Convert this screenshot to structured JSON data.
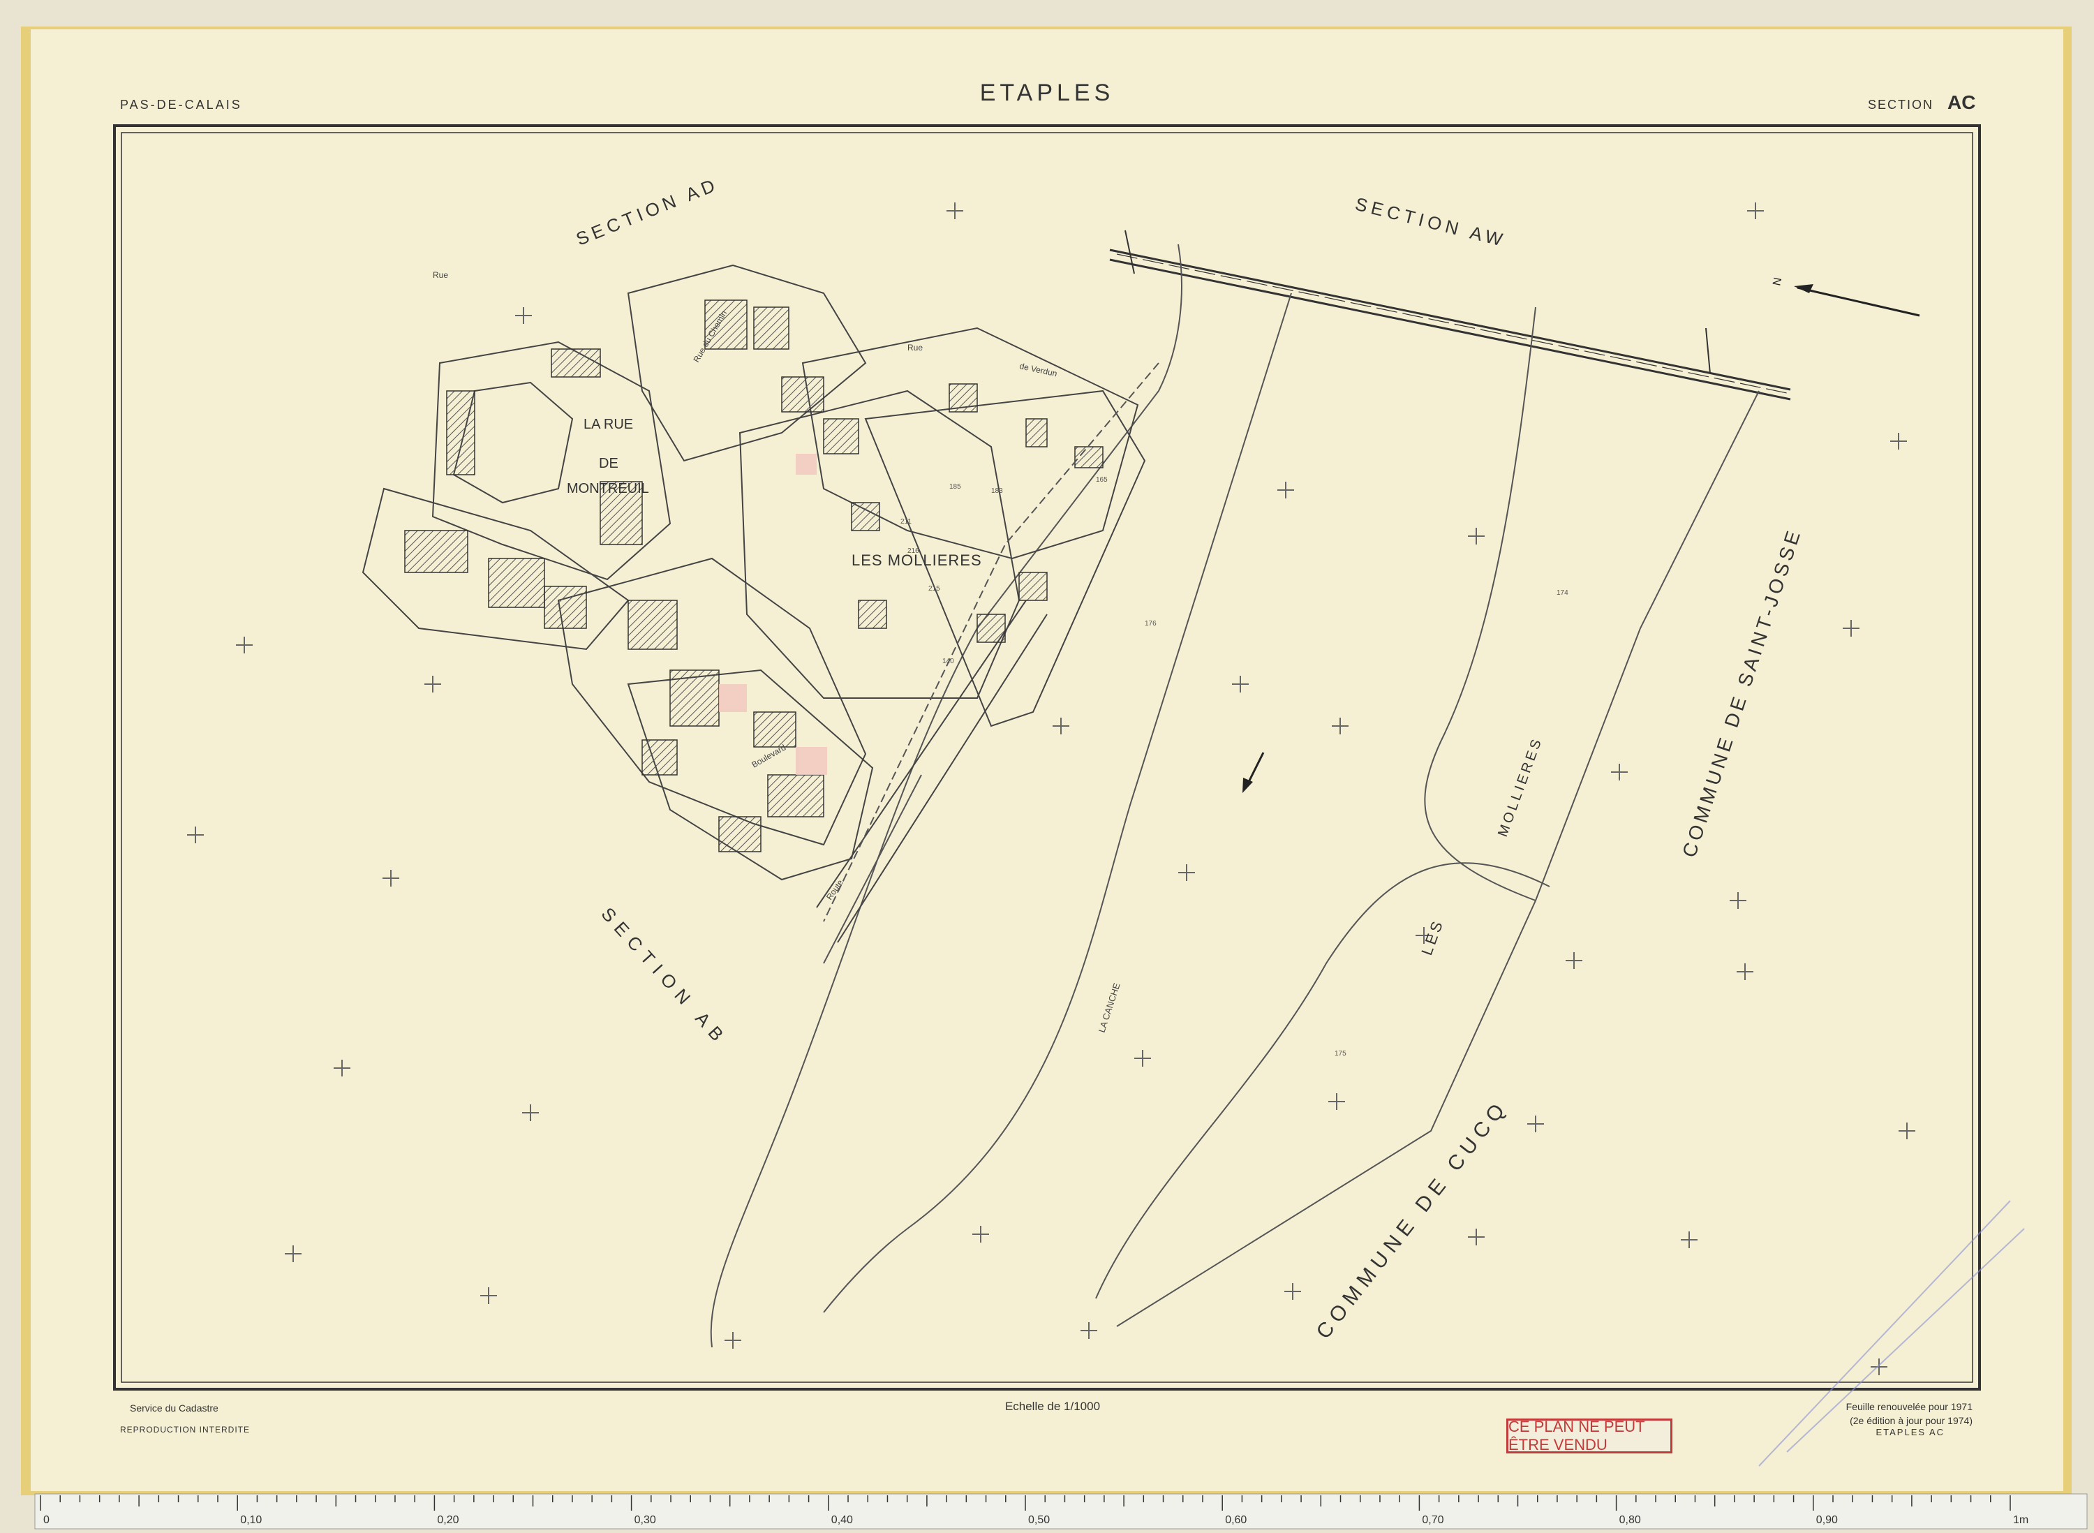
{
  "header": {
    "department": "PAS-DE-CALAIS",
    "commune": "ETAPLES",
    "section_prefix": "SECTION",
    "section_code": "AC"
  },
  "map_labels": {
    "section_ad": "SECTION AD",
    "section_aw": "SECTION AW",
    "section_ab": "SECTION AB",
    "la_rue_1": "LA RUE",
    "la_rue_2": "DE",
    "la_rue_3": "MONTREUIL",
    "les_mollieres": "LES MOLLIERES",
    "les_mollieres_v1": "LES",
    "les_mollieres_v2": "MOLLIERES",
    "commune_saint_josse": "COMMUNE DE SAINT-JOSSE",
    "commune_cucq": "COMMUNE DE CUCQ",
    "la_canche": "LA CANCHE",
    "north": "N",
    "streets": [
      "Rue",
      "de Verdun",
      "Rue du Chemin",
      "Boulevard",
      "Rue",
      "Route"
    ]
  },
  "parcel_numbers": [
    "174",
    "175",
    "176",
    "211",
    "215",
    "216",
    "183",
    "185",
    "140",
    "165"
  ],
  "footer": {
    "left_1": "Service du Cadastre",
    "left_2": "REPRODUCTION INTERDITE",
    "scale": "Echelle de 1/1000",
    "right_1": "Feuille renouvelée pour 1971",
    "right_2": "(2e édition à jour pour 1974)",
    "right_3": "ETAPLES AC",
    "stamp": "CE PLAN NE PEUT ÊTRE VENDU"
  },
  "ruler": {
    "labels": [
      "0",
      "0,10",
      "0,20",
      "0,30",
      "0,40",
      "0,50",
      "0,60",
      "0,70",
      "0,80",
      "0,90",
      "1m"
    ]
  },
  "colors": {
    "paper": "#f5f0d4",
    "ink": "#4a4a44",
    "stamp": "#c23a3a",
    "edge": "#e6cf78"
  }
}
